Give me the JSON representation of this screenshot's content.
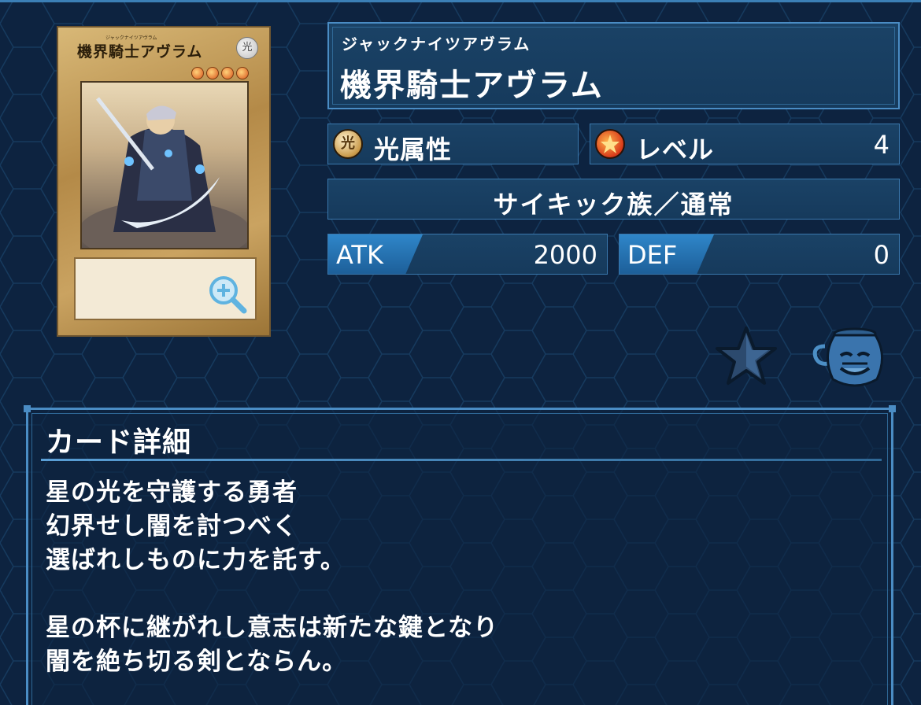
{
  "card_image": {
    "name": "機界騎士アヴラム",
    "ruby": "ジャックナイツアヴラム",
    "attribute_glyph": "光",
    "level_stars": 4,
    "zoom_icon": "magnify-plus-icon"
  },
  "header": {
    "ruby": "ジャックナイツアヴラム",
    "title": "機界騎士アヴラム"
  },
  "attribute": {
    "icon": "light-attribute-icon",
    "glyph": "光",
    "label": "光属性"
  },
  "level": {
    "icon": "level-star-icon",
    "label": "レベル",
    "value": "4"
  },
  "type_line": "サイキック族／通常",
  "atk": {
    "label": "ATK",
    "value": "2000"
  },
  "def": {
    "label": "DEF",
    "value": "0"
  },
  "actions": {
    "favorite_icon": "star-icon",
    "pot_icon": "pot-of-greed-icon"
  },
  "details": {
    "title": "カード詳細",
    "text": "星の光を守護する勇者\n幻界せし闇を討つべく\n選ばれしものに力を託す。\n\n星の杯に継がれし意志は新たな鍵となり\n闇を絶ち切る剣とならん。"
  },
  "colors": {
    "background": "#0d2340",
    "panel": "#1a4266",
    "border": "#4a8cc4",
    "accent": "#2f86c9"
  }
}
